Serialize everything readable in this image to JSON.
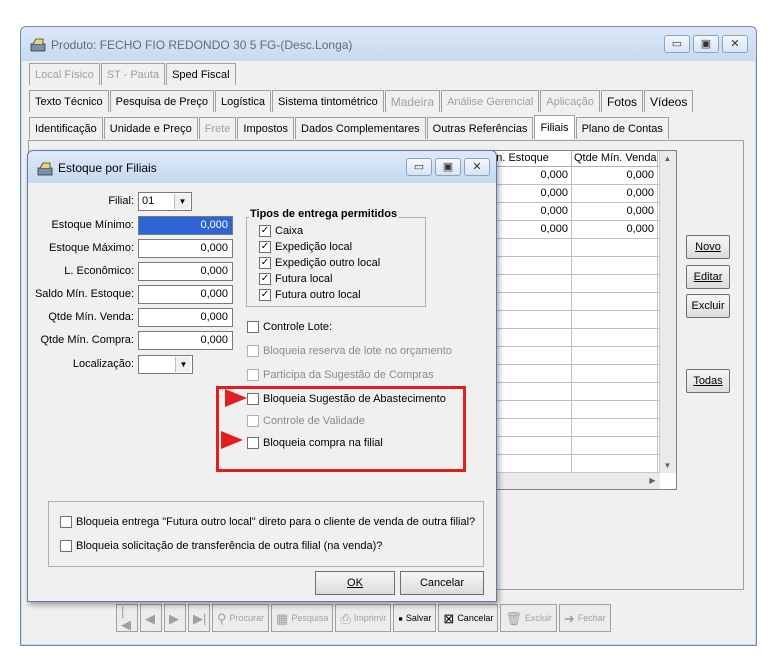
{
  "main_window": {
    "title": "Produto: FECHO FIO REDONDO 30  5 FG-(Desc.Longa)",
    "controls": {
      "minimize": "▭",
      "maximize": "▣",
      "close": "✕"
    }
  },
  "tabs_row1": [
    "Local Físico",
    "ST - Pauta",
    "Sped Fiscal"
  ],
  "tabs_row2": [
    "Texto Técnico",
    "Pesquisa de Preço",
    "Logística",
    "Sistema tintométrico",
    "Madeira",
    "Análise Gerencial",
    "Aplicação",
    "Fotos",
    "Vídeos"
  ],
  "tabs_row3": [
    "Identificação",
    "Unidade e Preço",
    "Frete",
    "Impostos",
    "Dados Complementares",
    "Outras Referências",
    "Filiais",
    "Plano de Contas"
  ],
  "grid": {
    "headers": [
      "Mín. Estoque",
      "Qtde Mín. Venda"
    ],
    "rows": [
      [
        "0,000",
        "0,000"
      ],
      [
        "0,000",
        "0,000"
      ],
      [
        "0,000",
        "0,000"
      ],
      [
        "0,000",
        "0,000"
      ]
    ]
  },
  "side_buttons": {
    "novo": "Novo",
    "editar": "Editar",
    "excluir": "Excluir",
    "todas": "Todas"
  },
  "toolbar": {
    "procurar": "Procurar",
    "pesquisa": "Pesquisa",
    "imprimir": "Imprimir",
    "salvar": "Salvar",
    "cancelar": "Cancelar",
    "excluir": "Excluir",
    "fechar": "Fechar"
  },
  "dialog": {
    "title": "Estoque por Filiais",
    "filial_label": "Filial:",
    "filial_value": "01",
    "estoque_minimo_label": "Estoque Mínimo:",
    "estoque_minimo_value": "0,000",
    "estoque_maximo_label": "Estoque Máximo:",
    "estoque_maximo_value": "0,000",
    "lote_economico_label": "L. Econômico:",
    "lote_economico_value": "0,000",
    "saldo_min_label": "Saldo Mín. Estoque:",
    "saldo_min_value": "0,000",
    "qtde_min_venda_label": "Qtde Mín. Venda:",
    "qtde_min_venda_value": "0,000",
    "qtde_min_compra_label": "Qtde Mín. Compra:",
    "qtde_min_compra_value": "0,000",
    "localizacao_label": "Localização:",
    "localizacao_value": "",
    "tipos_title": "Tipos de entrega permitidos",
    "tipos": [
      "Caixa",
      "Expedição local",
      "Expedição outro local",
      "Futura local",
      "Futura outro local"
    ],
    "controle_lote": "Controle Lote:",
    "bloqueia_reserva": "Bloqueia reserva de lote no orçamento",
    "participa_sugestao": "Participa da Sugestão de Compras",
    "bloqueia_sugestao": "Bloqueia Sugestão de Abastecimento",
    "controle_validade": "Controle de Validade",
    "bloqueia_compra": "Bloqueia compra na filial",
    "bloqueia_entrega": "Bloqueia entrega \"Futura outro local\" direto para o cliente de venda de outra filial?",
    "bloqueia_solicitacao": "Bloqueia solicitação de transferência de outra filial (na venda)?",
    "ok": "OK",
    "cancelar": "Cancelar"
  },
  "colors": {
    "highlight": "#e02020",
    "selection": "#2f64d6"
  }
}
